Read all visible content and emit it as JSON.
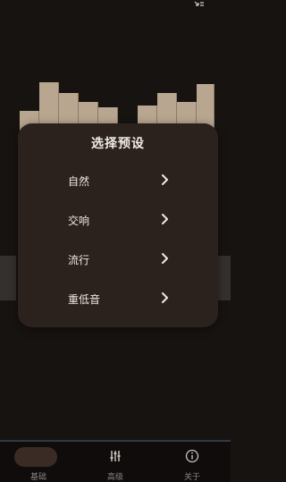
{
  "dialog": {
    "title": "选择预设",
    "presets": [
      {
        "label": "自然"
      },
      {
        "label": "交响"
      },
      {
        "label": "流行"
      },
      {
        "label": "重低音"
      }
    ]
  },
  "bottom_nav": {
    "items": [
      {
        "label": "基础",
        "icon": "basic-pill-icon",
        "active": true
      },
      {
        "label": "高级",
        "icon": "sliders-icon",
        "active": false
      },
      {
        "label": "关于",
        "icon": "info-icon",
        "active": false
      }
    ]
  },
  "colors": {
    "background": "#171311",
    "dialog": "#2b221e",
    "eq_bar": "#b9a690",
    "accent_pill": "#3a2c24",
    "nav_line": "#2d3a44"
  }
}
